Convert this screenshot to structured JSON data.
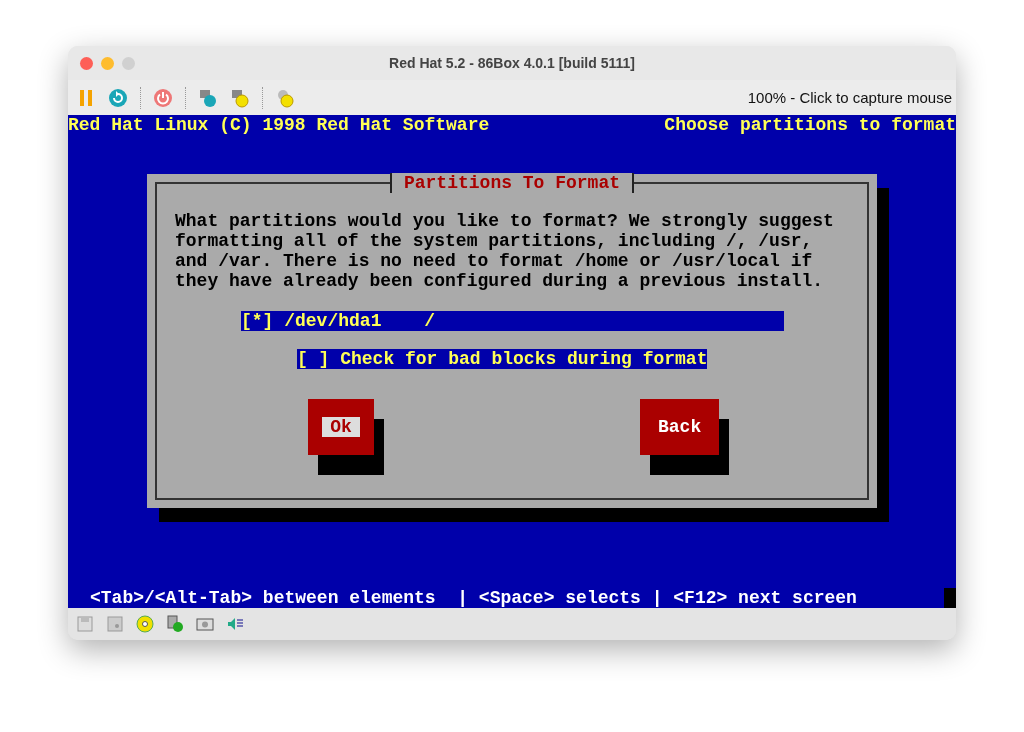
{
  "window": {
    "title": "Red Hat 5.2 - 86Box 4.0.1 [build 5111]"
  },
  "toolbar": {
    "status": "100% - Click to capture mouse"
  },
  "screen": {
    "header_left": "Red Hat Linux (C) 1998 Red Hat Software",
    "header_right": "Choose partitions to format",
    "checkbox_glyphs": {
      "checked": "[*]",
      "unchecked": "[ ]"
    },
    "dialog": {
      "title": "Partitions To Format",
      "message": "What partitions would you like to format? We strongly suggest formatting all of the system partitions, including /, /usr, and /var. There is no need to format /home or /usr/local if they have already been configured during a previous install.",
      "partitions": [
        {
          "device": "/dev/hda1",
          "mount": "/",
          "checked": true,
          "selected": true
        }
      ],
      "bad_blocks": {
        "label": "Check for bad blocks during format",
        "checked": false
      },
      "buttons": [
        {
          "label": "Ok",
          "focused": true
        },
        {
          "label": "Back",
          "focused": false
        }
      ]
    },
    "help_line": "<Tab>/<Alt-Tab> between elements  | <Space> selects | <F12> next screen"
  }
}
